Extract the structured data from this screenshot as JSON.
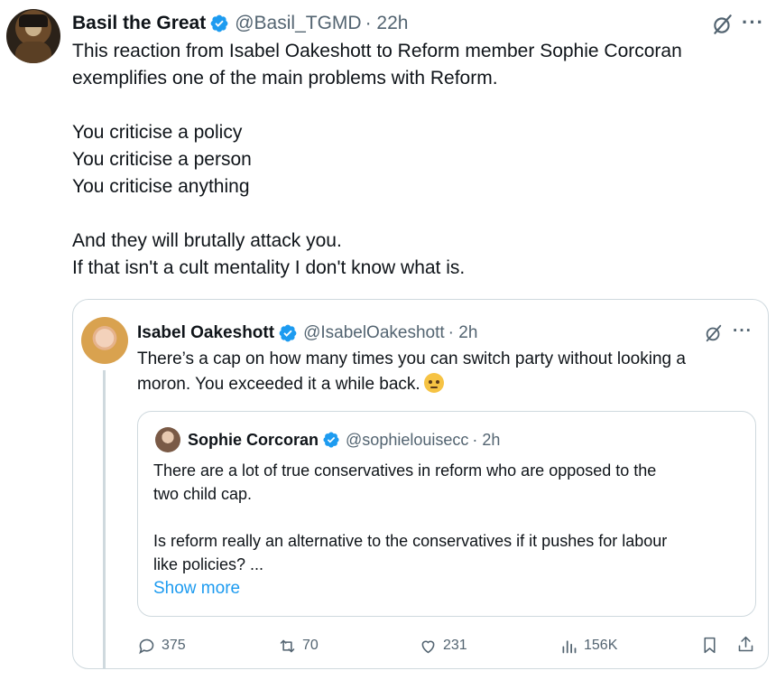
{
  "main_tweet": {
    "name": "Basil the Great",
    "handle": "@Basil_TGMD",
    "time": "· 22h",
    "more_label": "···",
    "text": "This reaction from Isabel Oakeshott to Reform member Sophie Corcoran\nexemplifies one of the main problems with Reform.\n\nYou criticise a policy\nYou criticise a person\nYou criticise anything\n\nAnd they will brutally attack you.\nIf that isn't a cult mentality I don't know what is."
  },
  "quoted_tweet": {
    "name": "Isabel Oakeshott",
    "handle": "@IsabelOakeshott",
    "time": "· 2h",
    "more_label": "···",
    "text": "There’s a cap on how many times you can switch party without looking a\nmoron. You exceeded it a while back.",
    "emoji": "rolling-eyes-face"
  },
  "nested_quote": {
    "name": "Sophie Corcoran",
    "handle": "@sophielouisecc",
    "time": "· 2h",
    "text": "There are a lot of true conservatives in reform who are opposed to the\ntwo child cap.\n\nIs reform really an alternative to the conservatives if it pushes for labour\nlike policies? ...",
    "show_more": "Show more"
  },
  "actions": {
    "replies": "375",
    "reposts": "70",
    "likes": "231",
    "views": "156K"
  },
  "colors": {
    "text": "#0f1419",
    "secondary": "#536471",
    "accent": "#1d9bf0",
    "border": "#cfd9de"
  }
}
